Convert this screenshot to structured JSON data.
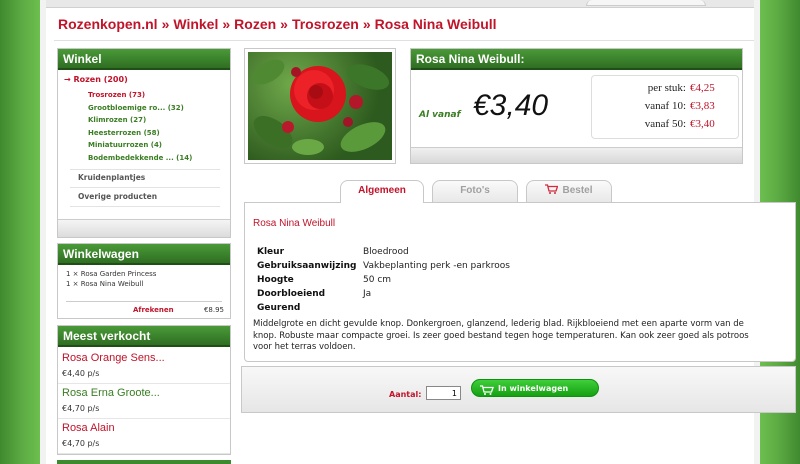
{
  "breadcrumb": [
    "Rozenkopen.nl",
    "Winkel",
    "Rozen",
    "Trosrozen",
    "Rosa Nina Weibull"
  ],
  "breadcrumb_sep": "»",
  "shop": {
    "title": "Winkel",
    "root": "→ Rozen (200)",
    "subcategories": [
      "Trosrozen (73)",
      "Grootbloemige ro... (32)",
      "Klimrozen (27)",
      "Heesterrozen (58)",
      "Miniatuurrozen (4)",
      "Bodembedekkende ... (14)"
    ],
    "others": [
      "Kruidenplantjes",
      "Overige producten"
    ]
  },
  "cart": {
    "title": "Winkelwagen",
    "items": [
      "1 × Rosa Garden Princess",
      "1 × Rosa Nina Weibull"
    ],
    "checkout_label": "Afrekenen",
    "total": "€8.95"
  },
  "bestsellers": {
    "title": "Meest verkocht",
    "items": [
      {
        "name": "Rosa Orange Sens...",
        "price": "€4,40 p/s",
        "color": "#c0142a"
      },
      {
        "name": "Rosa Erna Groote...",
        "price": "€4,70 p/s",
        "color": "#3a7d23"
      },
      {
        "name": "Rosa Alain",
        "price": "€4,70 p/s",
        "color": "#c0142a"
      }
    ]
  },
  "product": {
    "name": "Rosa Nina Weibull:",
    "from_label": "Al vanaf",
    "from_price": "€3,40",
    "tiers": [
      {
        "label": "per stuk:",
        "price": "€4,25"
      },
      {
        "label": "vanaf 10:",
        "price": "€3,83"
      },
      {
        "label": "vanaf 50:",
        "price": "€3,40"
      }
    ]
  },
  "tabs": {
    "general": "Algemeen",
    "photos": "Foto's",
    "order": "Bestel"
  },
  "details": {
    "title": "Rosa Nina Weibull",
    "specs": [
      {
        "key": "Kleur",
        "value": "Bloedrood"
      },
      {
        "key": "Gebruiksaanwijzing",
        "value": "Vakbeplanting perk -en parkroos"
      },
      {
        "key": "Hoogte",
        "value": "50 cm"
      },
      {
        "key": "Doorbloeiend",
        "value": "Ja"
      },
      {
        "key": "Geurend",
        "value": ""
      }
    ],
    "description": "Middelgrote en dicht gevulde knop. Donkergroen, glanzend, lederig blad. Rijkbloeiend met een aparte vorm van de knop. Robuste maar compacte groei. Is zeer goed bestand tegen hoge temperaturen. Kan ook zeer goed als potroos voor het terras voldoen."
  },
  "order": {
    "qty_label": "Aantal:",
    "qty_value": "1",
    "add_label": "In winkelwagen"
  },
  "colors": {
    "brand_red": "#c0142a",
    "brand_green": "#3a7d23",
    "button_green": "#15a012"
  },
  "icons": [
    "arrow-right-icon",
    "shopping-cart-icon",
    "rose-photo"
  ]
}
